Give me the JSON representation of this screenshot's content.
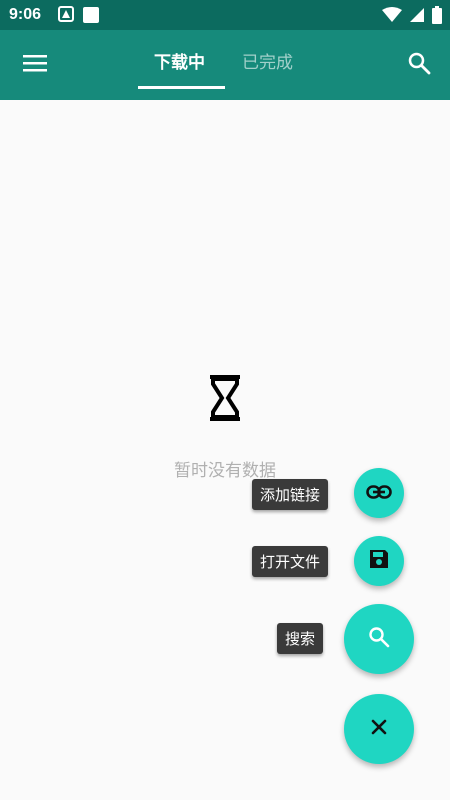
{
  "status_bar": {
    "time": "9:06",
    "icons": [
      "notification-icon",
      "square-icon",
      "wifi-icon",
      "cellular-icon",
      "battery-icon"
    ]
  },
  "app_bar": {
    "menu_icon": "menu-icon",
    "tabs": [
      {
        "label": "下载中",
        "active": true
      },
      {
        "label": "已完成",
        "active": false
      }
    ],
    "search_icon": "search-icon"
  },
  "empty_state": {
    "icon": "hourglass-icon",
    "message": "暂时没有数据"
  },
  "fab_menu": {
    "items": [
      {
        "label": "添加链接",
        "icon": "link-icon"
      },
      {
        "label": "打开文件",
        "icon": "save-icon"
      },
      {
        "label": "搜索",
        "icon": "search-icon"
      }
    ],
    "main_icon": "close-icon"
  },
  "colors": {
    "status_bar": "#0c6b5f",
    "app_bar": "#168a7b",
    "fab": "#1fd6c2",
    "label_bg": "#3a3a3a"
  }
}
